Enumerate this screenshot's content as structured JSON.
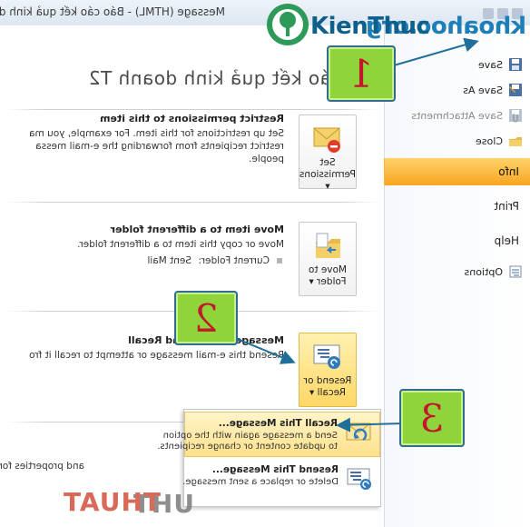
{
  "window": {
    "title": "Message (HTML)  -  Báo cáo kết quả kinh doanh T2"
  },
  "nav": {
    "items": [
      {
        "label": "Save"
      },
      {
        "label": "Save As"
      },
      {
        "label": "Save Attachments"
      },
      {
        "label": "Close"
      }
    ],
    "tabs": [
      {
        "label": "Info"
      },
      {
        "label": "Print"
      },
      {
        "label": "Help"
      },
      {
        "label": "Options"
      }
    ]
  },
  "main": {
    "doc_title": "Báo cáo kết quả kinh doanh T2",
    "permissions": {
      "button": [
        "Set",
        "Permissions"
      ],
      "heading": "Restrict permissions to this item",
      "lines": [
        "Set up restrictions for this item. For example, you ma",
        "restrict recipients from forwarding the e-mail messa",
        "people."
      ]
    },
    "move": {
      "button": [
        "Move to",
        "Folder"
      ],
      "heading": "Move item to a different folder",
      "lines": [
        "Move or copy this item to a different folder."
      ],
      "current_folder_label": "Current Folder:",
      "current_folder_value": "Sent Mail"
    },
    "resend": {
      "button": [
        "Resend or",
        "Recall"
      ],
      "heading": "Message Resend and Recall",
      "lines": [
        "Resend this e-mail message or attempt to recall it fro"
      ]
    },
    "properties": {
      "partial_text": "and properties for th"
    }
  },
  "dropdown": {
    "items": [
      {
        "label": "Recall This Message...",
        "lines": [
          "Send a message again with the option",
          "to update content or change recipients."
        ]
      },
      {
        "label": "Resend This Message...",
        "lines": [
          "Delete or replace a sent message."
        ]
      }
    ]
  },
  "callouts": [
    "1",
    "2",
    "3"
  ],
  "watermarks": {
    "logo_part1": "KienThuc",
    "logo_part2": "khoahoc.org",
    "bottom_part1": "TAUHT",
    "bottom_part2": "UHT"
  },
  "colors": {
    "accent_orange": "#f7a51f",
    "highlight_yellow": "#ffd765",
    "callout_green": "#8fd43b",
    "callout_number": "#c2182b",
    "arrow_blue": "#1f6f9a"
  }
}
